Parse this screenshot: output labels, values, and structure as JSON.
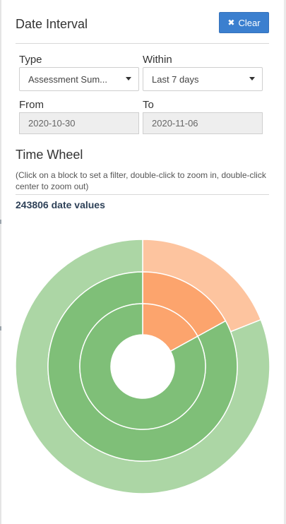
{
  "panel": {
    "title": "Date Interval",
    "clear_label": "Clear",
    "clear_icon": "close-icon"
  },
  "filters": {
    "type_label": "Type",
    "type_value": "Assessment Sum...",
    "within_label": "Within",
    "within_value": "Last 7 days",
    "from_label": "From",
    "from_value": "2020-10-30",
    "to_label": "To",
    "to_value": "2020-11-06"
  },
  "wheel": {
    "title": "Time Wheel",
    "hint": "(Click on a block to set a filter, double-click to zoom in, double-click center to zoom out)",
    "count_text": "243806 date values",
    "colors": {
      "outer_green": "#acd6a5",
      "outer_orange": "#fdc49f",
      "inner_green": "#7fbf78",
      "inner_orange": "#fca46d",
      "separator": "#ffffff"
    },
    "rings": [
      {
        "name": "outer",
        "segments": [
          {
            "fraction": 0.19,
            "color": "orange"
          },
          {
            "fraction": 0.81,
            "color": "green"
          }
        ]
      },
      {
        "name": "middle",
        "segments": [
          {
            "fraction": 0.17,
            "color": "orange"
          },
          {
            "fraction": 0.83,
            "color": "green"
          }
        ]
      },
      {
        "name": "inner",
        "segments": [
          {
            "fraction": 0.17,
            "color": "orange"
          },
          {
            "fraction": 0.83,
            "color": "green"
          }
        ]
      }
    ]
  }
}
